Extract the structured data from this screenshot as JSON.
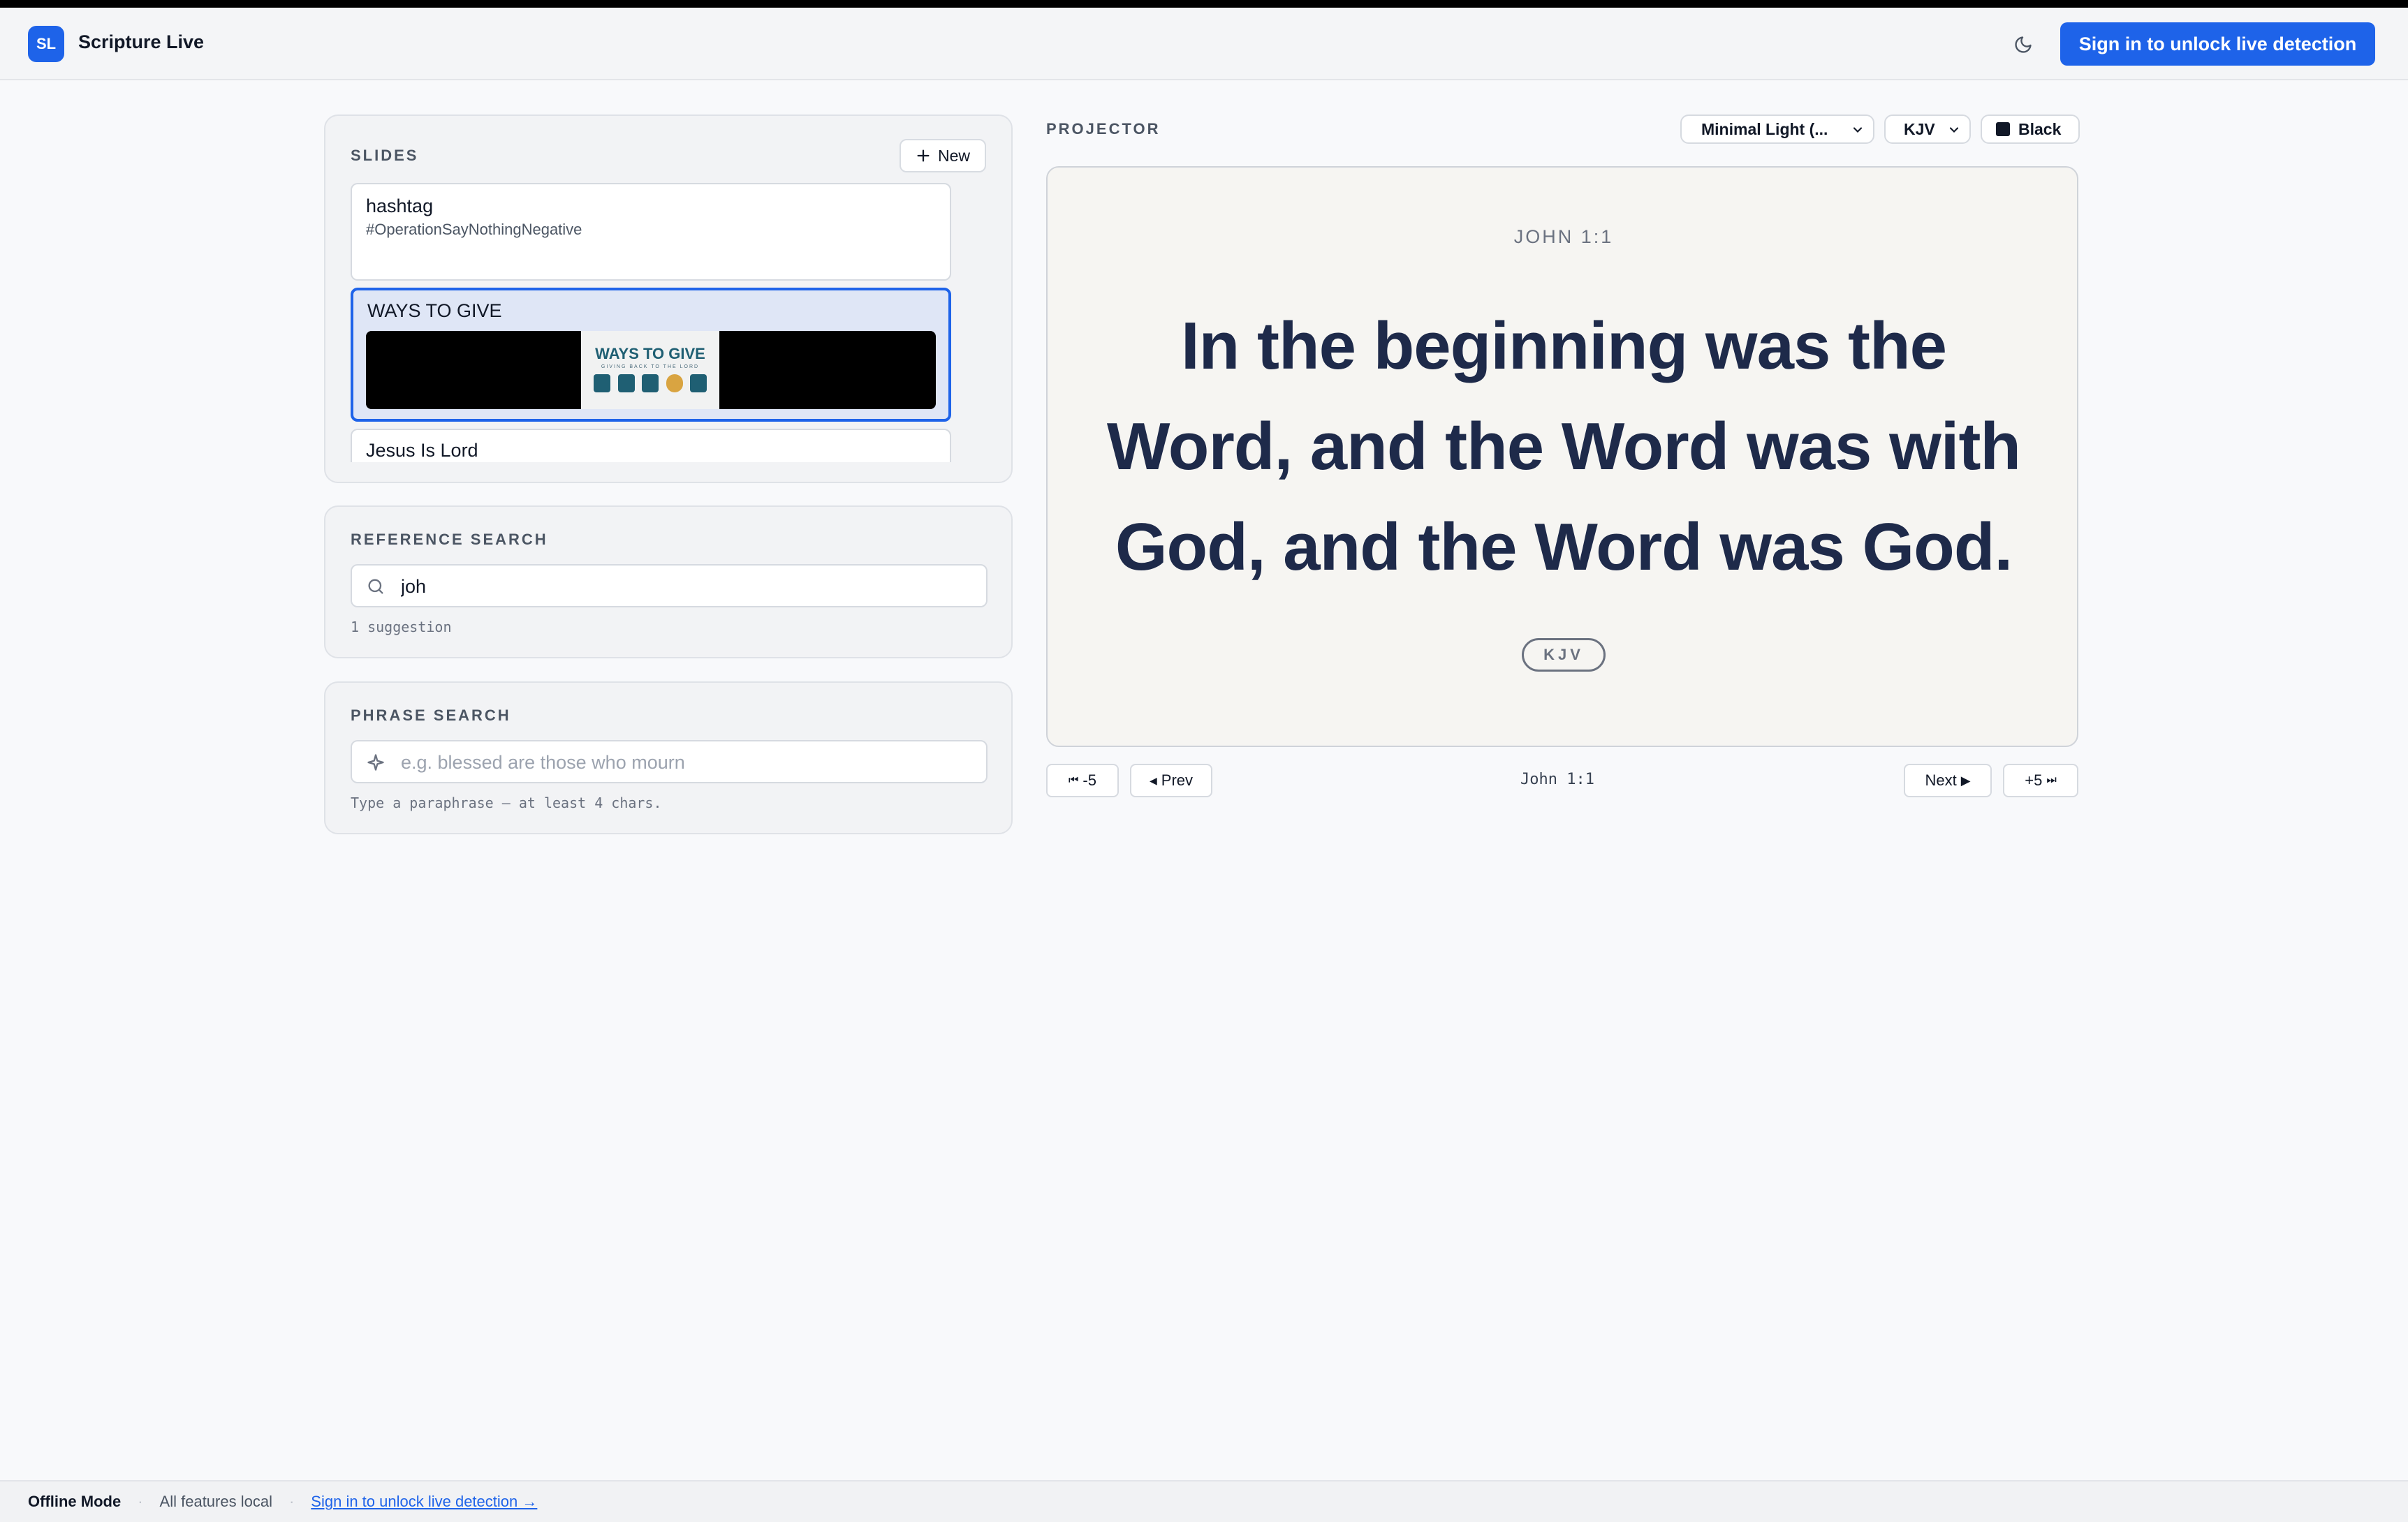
{
  "header": {
    "logo_text": "SL",
    "app_title": "Scripture Live",
    "theme_icon": "moon-icon",
    "signin_label": "Sign in to unlock live detection",
    "accent_color": "#1e63e9"
  },
  "slides": {
    "title": "SLIDES",
    "new_label": "New",
    "items": [
      {
        "title": "hashtag",
        "subtitle": "#OperationSayNothingNegative"
      },
      {
        "title": "WAYS TO GIVE",
        "thumb_title": "WAYS TO GIVE",
        "thumb_sub": "GIVING BACK TO THE LORD",
        "selected": true
      },
      {
        "title": "Jesus Is Lord"
      }
    ]
  },
  "reference_search": {
    "title": "REFERENCE SEARCH",
    "value": "joh",
    "hint": "1 suggestion"
  },
  "phrase_search": {
    "title": "PHRASE SEARCH",
    "placeholder": "e.g. blessed are those who mourn",
    "hint": "Type a paraphrase — at least 4 chars."
  },
  "projector": {
    "title": "PROJECTOR",
    "theme_select": "Minimal Light (...",
    "version_select": "KJV",
    "background_label": "Black",
    "reference": "JOHN 1:1",
    "verse_text": "In the beginning was the Word, and the Word was with God, and the Word was God.",
    "version_badge": "KJV",
    "nav": {
      "back5": "-5",
      "prev": "Prev",
      "status": "John 1:1",
      "next": "Next",
      "fwd5": "+5"
    }
  },
  "footer": {
    "mode": "Offline Mode",
    "local": "All features local",
    "link": "Sign in to unlock live detection →"
  }
}
